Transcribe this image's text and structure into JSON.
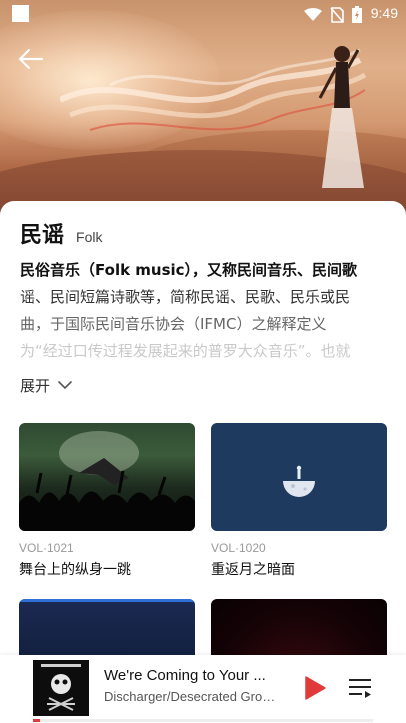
{
  "status_bar": {
    "time": "9:49"
  },
  "genre": {
    "title_zh": "民谣",
    "title_en": "Folk"
  },
  "description_lines": [
    "民俗音乐（Folk music），又称民间音乐、民间歌",
    "谣、民间短篇诗歌等，简称民谣、民歌、民乐或民",
    "曲，于国际民间音乐协会（IFMC）之解释定义",
    "为“经过口传过程发展起来的普罗大众音乐”。也就"
  ],
  "expand_label": "展开",
  "albums": [
    {
      "vol": "VOL·1021",
      "name": "舞台上的纵身一跳"
    },
    {
      "vol": "VOL·1020",
      "name": "重返月之暗面"
    },
    {
      "vol": "",
      "name": ""
    },
    {
      "vol": "",
      "name": ""
    }
  ],
  "player": {
    "title": "We're Coming to Your ...",
    "artist": "Discharger/Desecrated Grou...",
    "progress": 0.02
  },
  "colors": {
    "accent": "#e03b3b"
  },
  "icons": [
    "back-arrow-icon",
    "wifi-icon",
    "no-sim-icon",
    "battery-icon",
    "chevron-down-icon",
    "play-icon",
    "playlist-icon"
  ]
}
